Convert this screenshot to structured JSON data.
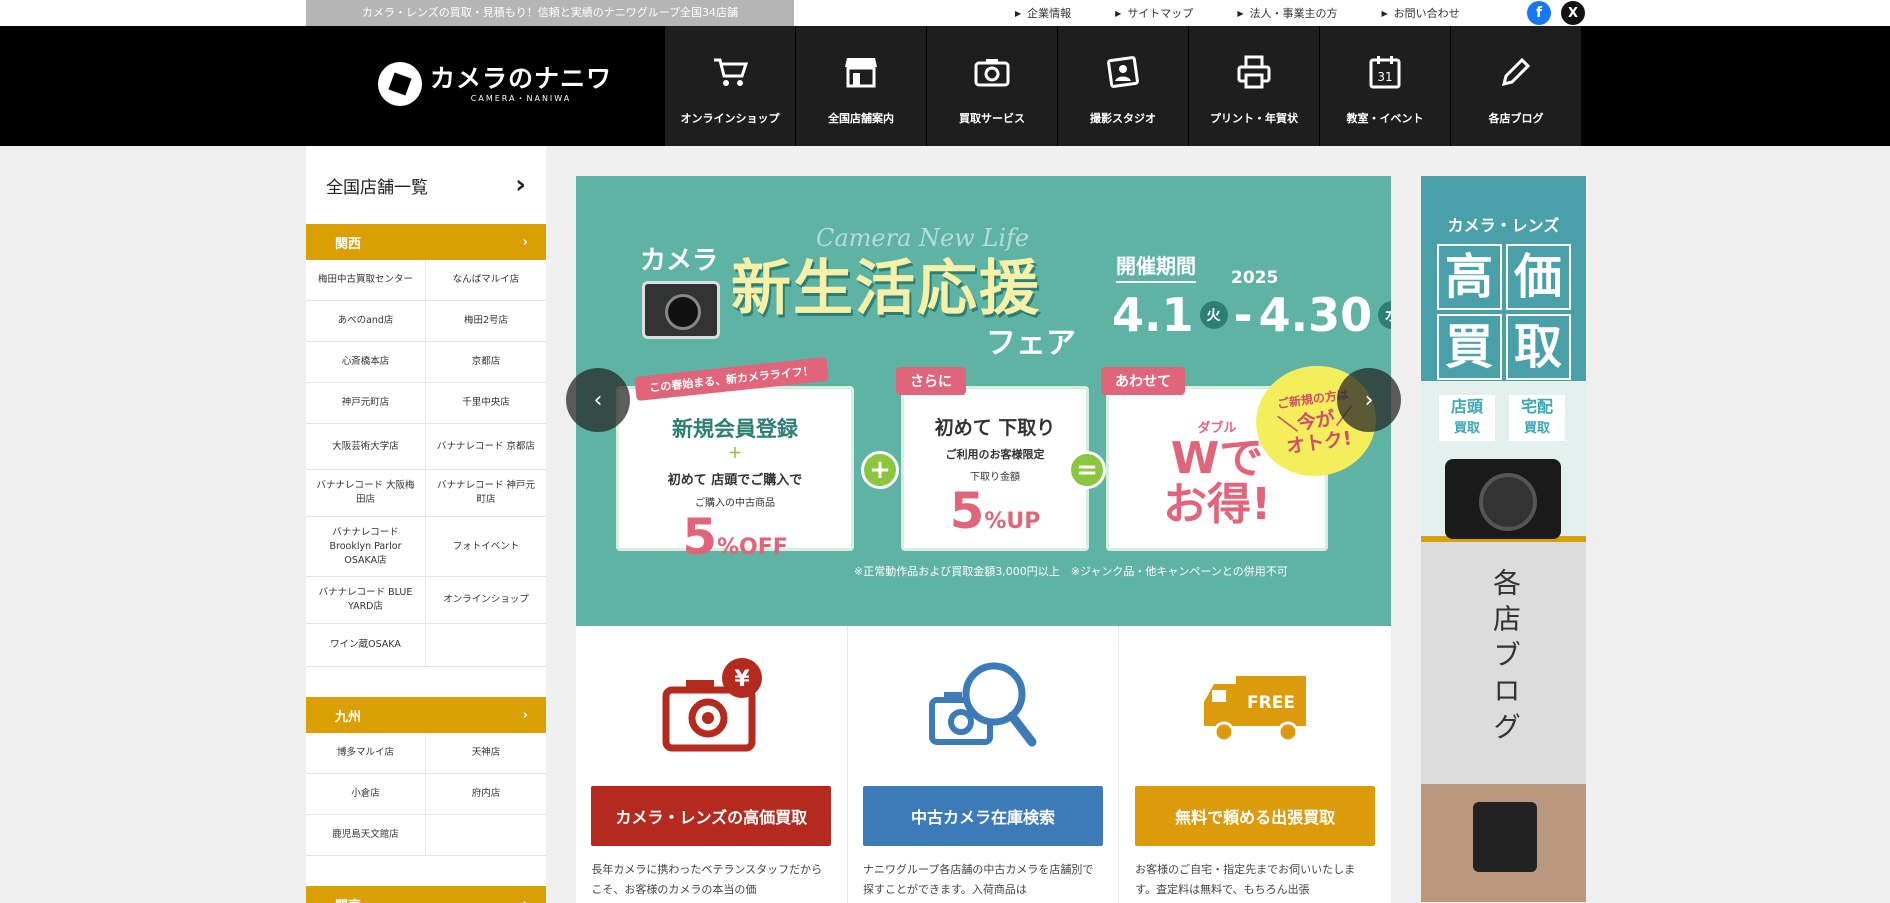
{
  "topbar": {
    "tagline": "カメラ・レンズの買取・見積もり！信頼と実績のナニワグループ全国34店舗",
    "links": [
      "企業情報",
      "サイトマップ",
      "法人・事業主の方",
      "お問い合わせ"
    ],
    "facebook": "f",
    "x": "X"
  },
  "logo": {
    "jp": "カメラのナニワ",
    "en": "CAMERA・NANIWA"
  },
  "nav": [
    {
      "label": "オンラインショップ",
      "icon": "cart-icon"
    },
    {
      "label": "全国店舗案内",
      "icon": "store-icon"
    },
    {
      "label": "買取サービス",
      "icon": "camera-icon"
    },
    {
      "label": "撮影スタジオ",
      "icon": "portrait-icon"
    },
    {
      "label": "プリント・年賀状",
      "icon": "printer-icon"
    },
    {
      "label": "教室・イベント",
      "icon": "calendar-icon",
      "day": "31"
    },
    {
      "label": "各店ブログ",
      "icon": "pencil-icon"
    }
  ],
  "sidebar": {
    "title": "全国店舗一覧",
    "regions": [
      {
        "name": "関西",
        "stores": [
          "梅田中古買取センター",
          "なんばマルイ店",
          "あべのand店",
          "梅田2号店",
          "心斎橋本店",
          "京都店",
          "神戸元町店",
          "千里中央店",
          "大阪芸術大学店",
          "バナナレコード 京都店",
          "バナナレコード 大阪梅田店",
          "バナナレコード 神戸元町店",
          "バナナレコード Brooklyn Parlor OSAKA店",
          "フォトイベント",
          "バナナレコード BLUE YARD店",
          "オンラインショップ",
          "ワイン蔵OSAKA",
          ""
        ]
      },
      {
        "name": "九州",
        "stores": [
          "博多マルイ店",
          "天神店",
          "小倉店",
          "府内店",
          "鹿児島天文館店",
          ""
        ]
      },
      {
        "name": "関東",
        "stores": []
      }
    ]
  },
  "banner": {
    "script": "Camera New Life",
    "camera": "カメラ",
    "title": "新生活応援",
    "fair": "フェア",
    "period_label": "開催期間",
    "year": "2025",
    "start": "4.1",
    "start_day": "火",
    "dash": "-",
    "end": "4.30",
    "end_day": "水",
    "card1": {
      "tag": "この春始まる、新カメラライフ！",
      "head": "新規会員登録",
      "plus": "＋",
      "sub": "初めて 店頭でご購入で",
      "small": "ご購入の中古商品",
      "big": "5",
      "unit": "%OFF"
    },
    "card2": {
      "tag": "さらに",
      "head": "初めて 下取り",
      "sub": "ご利用のお客様限定",
      "small": "下取り金額",
      "big": "5",
      "unit": "%UP"
    },
    "card3": {
      "tag": "あわせて",
      "small": "ダブル",
      "big": "Wで",
      "big2": "お得!"
    },
    "op_plus": "+",
    "op_eq": "=",
    "bubble": {
      "l1": "ご新規の方は",
      "l2": "＼今が／",
      "l3": "オトク!"
    },
    "note": "※正常動作品および買取金額3,000円以上　※ジャンク品・他キャンペーンとの併用不可",
    "prev": "‹",
    "next": "›"
  },
  "services": [
    {
      "button": "カメラ・レンズの高価買取",
      "text": "長年カメラに携わったベテランスタッフだからこそ、お客様のカメラの本当の価",
      "color": "#b52a1e",
      "icon": "yen-camera-icon",
      "badge": "¥"
    },
    {
      "button": "中古カメラ在庫検索",
      "text": "ナニワグループ各店舗の中古カメラを店舗別で探すことができます。入荷商品は",
      "color": "#3d7ab8",
      "icon": "camera-search-icon"
    },
    {
      "button": "無料で頼める出張買取",
      "text": "お客様のご自宅・指定先までお伺いいたします。査定料は無料で、もちろん出張",
      "color": "#db9b0b",
      "icon": "free-truck-icon",
      "badge": "FREE"
    }
  ],
  "right": {
    "small": "カメラ・レンズ",
    "big": [
      "高",
      "価",
      "買",
      "取"
    ],
    "tag1": {
      "l1": "店頭",
      "l2": "買取"
    },
    "tag2": {
      "l1": "宅配",
      "l2": "買取"
    },
    "blog": "各店ブログ"
  },
  "colors": {
    "accent": "#d99f05",
    "header": "#000000",
    "teal": "#5eb3a4"
  }
}
